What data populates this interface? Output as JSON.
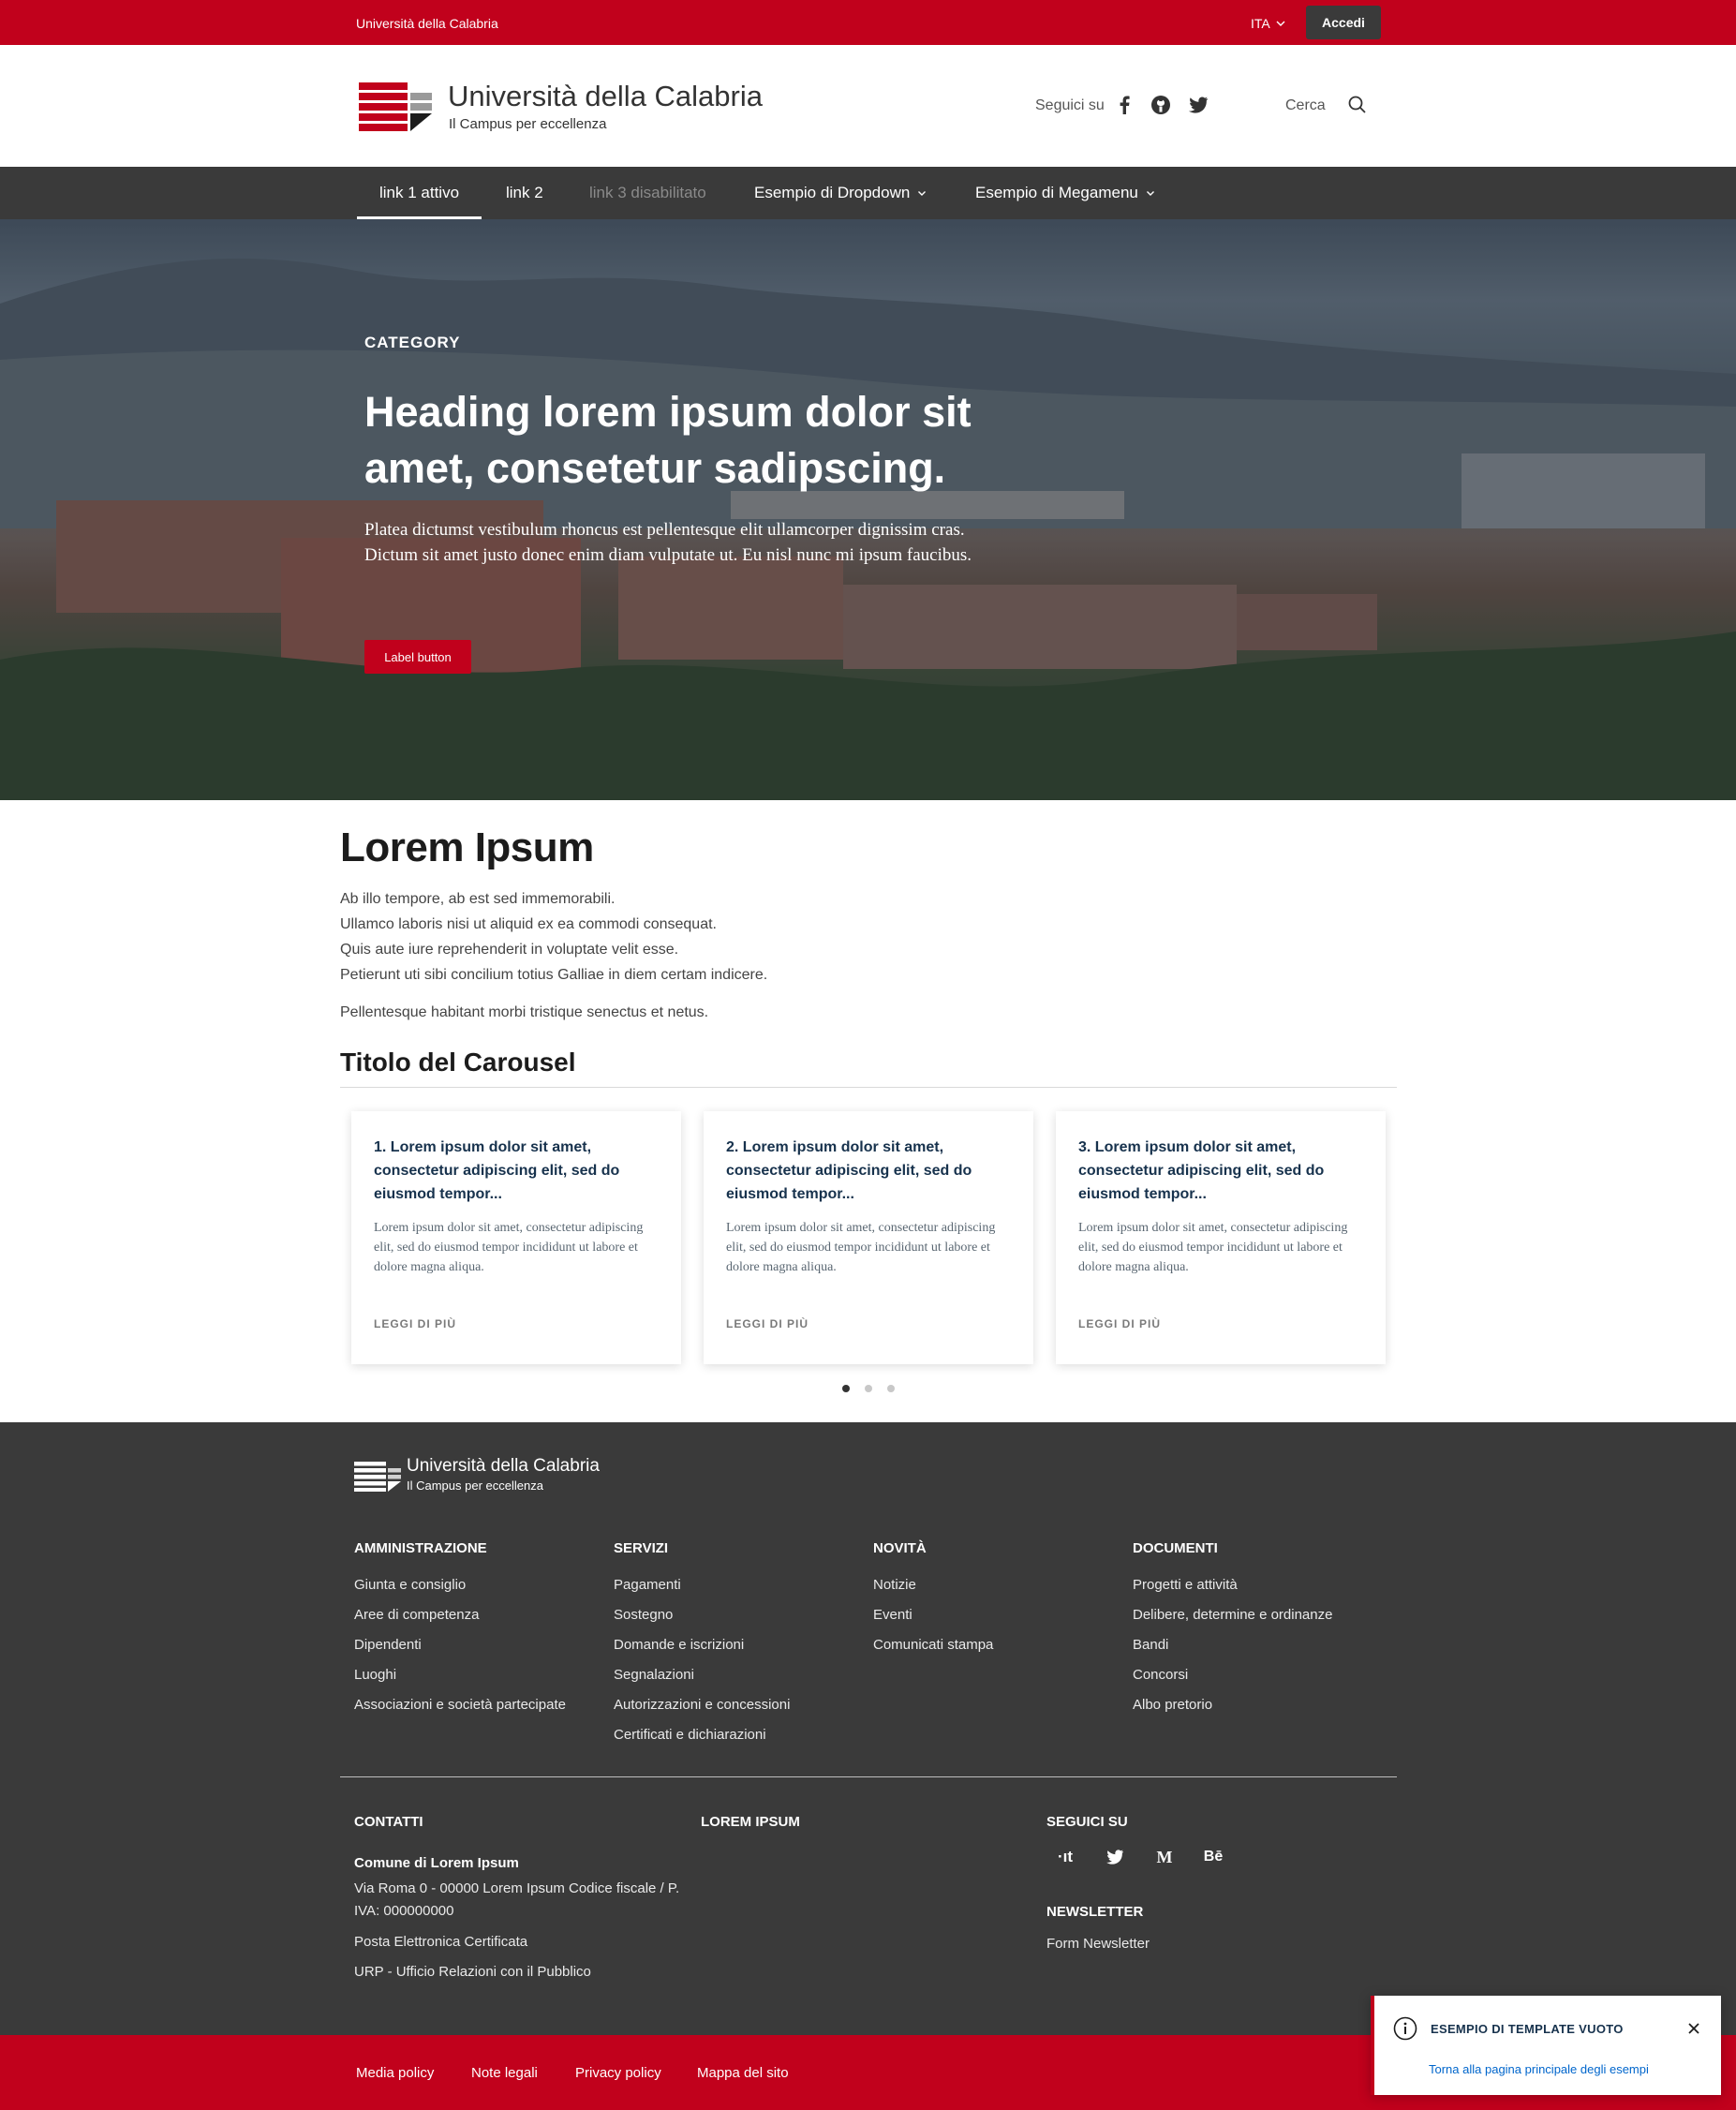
{
  "topbar": {
    "university": "Università della Calabria",
    "language": "ITA",
    "login": "Accedi"
  },
  "header": {
    "title": "Università della Calabria",
    "subtitle": "Il Campus per eccellenza",
    "follow_label": "Seguici su",
    "search_label": "Cerca",
    "social_icons": [
      "facebook-icon",
      "github-icon",
      "twitter-icon"
    ]
  },
  "nav": {
    "items": [
      {
        "label": "link 1 attivo",
        "state": "active"
      },
      {
        "label": "link 2",
        "state": "normal"
      },
      {
        "label": "link 3 disabilitato",
        "state": "disabled"
      },
      {
        "label": "Esempio di Dropdown",
        "state": "dropdown"
      },
      {
        "label": "Esempio di Megamenu",
        "state": "dropdown"
      }
    ]
  },
  "hero": {
    "category": "CATEGORY",
    "title": "Heading lorem ipsum dolor sit amet, consetetur sadipscing.",
    "text": "Platea dictumst vestibulum rhoncus est pellentesque elit ullamcorper dignissim cras. Dictum sit amet justo donec enim diam vulputate ut. Eu nisl nunc mi ipsum faucibus.",
    "button": "Label button"
  },
  "main": {
    "title": "Lorem Ipsum",
    "lines": [
      "Ab illo tempore, ab est sed immemorabili.",
      "Ullamco laboris nisi ut aliquid ex ea commodi consequat.",
      "Quis aute iure reprehenderit in voluptate velit esse.",
      "Petierunt uti sibi concilium totius Galliae in diem certam indicere."
    ],
    "extra": "Pellentesque habitant morbi tristique senectus et netus."
  },
  "carousel": {
    "title": "Titolo del Carousel",
    "cards": [
      {
        "title": "1. Lorem ipsum dolor sit amet, consectetur adipiscing elit, sed do eiusmod tempor...",
        "text": "Lorem ipsum dolor sit amet, consectetur adipiscing elit, sed do eiusmod tempor incididunt ut labore et dolore magna aliqua.",
        "more": "LEGGI DI PIÙ"
      },
      {
        "title": "2. Lorem ipsum dolor sit amet, consectetur adipiscing elit, sed do eiusmod tempor...",
        "text": "Lorem ipsum dolor sit amet, consectetur adipiscing elit, sed do eiusmod tempor incididunt ut labore et dolore magna aliqua.",
        "more": "LEGGI DI PIÙ"
      },
      {
        "title": "3. Lorem ipsum dolor sit amet, consectetur adipiscing elit, sed do eiusmod tempor...",
        "text": "Lorem ipsum dolor sit amet, consectetur adipiscing elit, sed do eiusmod tempor incididunt ut labore et dolore magna aliqua.",
        "more": "LEGGI DI PIÙ"
      }
    ],
    "active_page": 1,
    "pages": 3
  },
  "footer": {
    "title": "Università della Calabria",
    "subtitle": "Il Campus per eccellenza",
    "columns": [
      {
        "heading": "AMMINISTRAZIONE",
        "links": [
          "Giunta e consiglio",
          "Aree di competenza",
          "Dipendenti",
          "Luoghi",
          "Associazioni e società partecipate"
        ]
      },
      {
        "heading": "SERVIZI",
        "links": [
          "Pagamenti",
          "Sostegno",
          "Domande e iscrizioni",
          "Segnalazioni",
          "Autorizzazioni e concessioni",
          "Certificati e dichiarazioni"
        ]
      },
      {
        "heading": "NOVITÀ",
        "links": [
          "Notizie",
          "Eventi",
          "Comunicati stampa"
        ]
      },
      {
        "heading": "DOCUMENTI",
        "links": [
          "Progetti e attività",
          "Delibere, determine e ordinanze",
          "Bandi",
          "Concorsi",
          "Albo pretorio"
        ]
      }
    ],
    "contacts": {
      "heading": "CONTATTI",
      "org": "Comune di Lorem Ipsum",
      "address": "Via Roma 0 - 00000 Lorem Ipsum Codice fiscale / P. IVA: 000000000",
      "pec": "Posta Elettronica Certificata",
      "urp": "URP - Ufficio Relazioni con il Pubblico"
    },
    "lorem_heading": "LOREM IPSUM",
    "follow": {
      "heading": "SEGUICI SU",
      "icons": [
        "designers-italia-icon",
        "twitter-icon",
        "medium-icon",
        "behance-icon"
      ],
      "glyphs": [
        "·ıt",
        "",
        "M",
        "Bē"
      ]
    },
    "newsletter": {
      "heading": "NEWSLETTER",
      "link": "Form Newsletter"
    }
  },
  "bottombar": {
    "links": [
      "Media policy",
      "Note legali",
      "Privacy policy",
      "Mappa del sito"
    ]
  },
  "toast": {
    "title": "ESEMPIO DI TEMPLATE VUOTO",
    "link": "Torna alla pagina principale degli esempi"
  },
  "colors": {
    "brand_red": "#c1011c",
    "dark_gray": "#3a3a3a",
    "card_title": "#17324d",
    "link_blue": "#0066cc"
  }
}
